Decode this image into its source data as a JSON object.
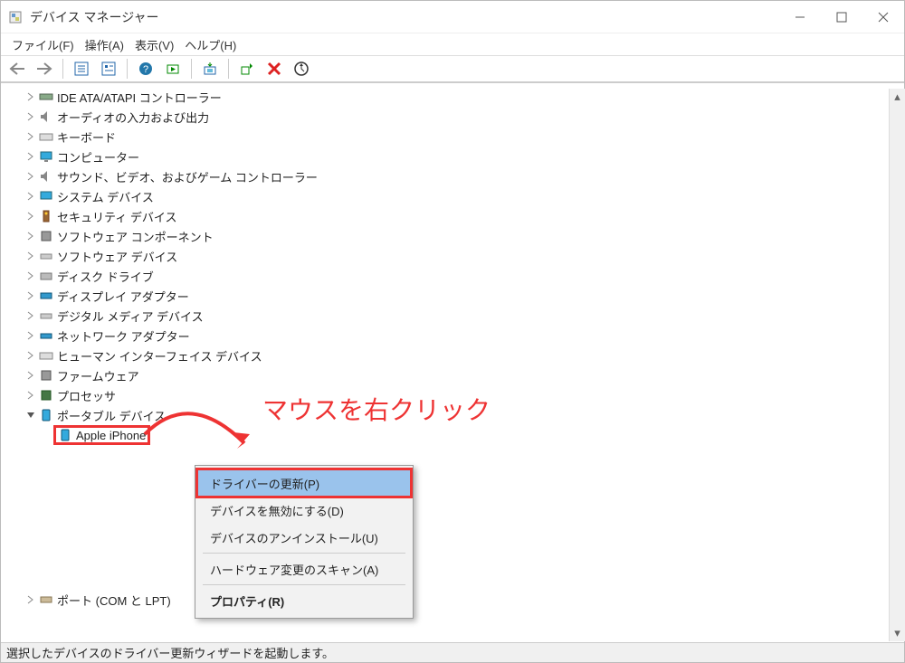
{
  "window": {
    "title": "デバイス マネージャー"
  },
  "menubar": {
    "file": "ファイル(F)",
    "action": "操作(A)",
    "view": "表示(V)",
    "help": "ヘルプ(H)"
  },
  "tree": {
    "ide": "IDE ATA/ATAPI コントローラー",
    "audio": "オーディオの入力および出力",
    "keyboard": "キーボード",
    "computer": "コンピューター",
    "sound": "サウンド、ビデオ、およびゲーム コントローラー",
    "system": "システム デバイス",
    "security": "セキュリティ デバイス",
    "swcomp": "ソフトウェア コンポーネント",
    "swdev": "ソフトウェア デバイス",
    "disk": "ディスク ドライブ",
    "display": "ディスプレイ アダプター",
    "digitalmedia": "デジタル メディア デバイス",
    "network": "ネットワーク アダプター",
    "hid": "ヒューマン インターフェイス デバイス",
    "firmware": "ファームウェア",
    "processor": "プロセッサ",
    "portable": "ポータブル デバイス",
    "appleiphone": "Apple iPhone",
    "ports": "ポート (COM と LPT)"
  },
  "context_menu": {
    "update": "ドライバーの更新(P)",
    "disable": "デバイスを無効にする(D)",
    "uninstall": "デバイスのアンインストール(U)",
    "scan": "ハードウェア変更のスキャン(A)",
    "properties": "プロパティ(R)"
  },
  "annotation": {
    "text": "マウスを右クリック"
  },
  "statusbar": {
    "text": "選択したデバイスのドライバー更新ウィザードを起動します。"
  }
}
